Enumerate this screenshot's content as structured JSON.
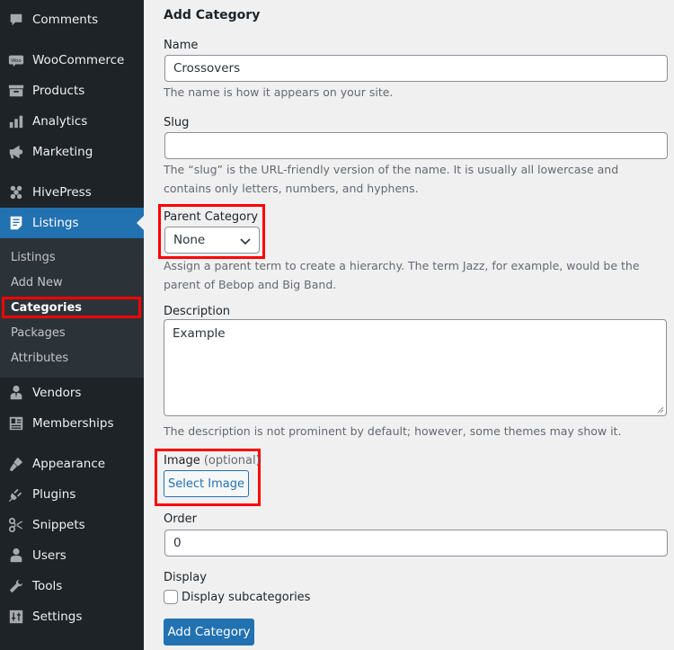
{
  "sidebar": {
    "items": [
      {
        "label": "Comments",
        "icon": "comment-icon"
      },
      {
        "label": "WooCommerce",
        "icon": "woo-icon"
      },
      {
        "label": "Products",
        "icon": "archive-icon"
      },
      {
        "label": "Analytics",
        "icon": "bar-chart-icon"
      },
      {
        "label": "Marketing",
        "icon": "megaphone-icon"
      },
      {
        "label": "HivePress",
        "icon": "hivepress-icon"
      },
      {
        "label": "Listings",
        "icon": "listing-icon",
        "active": true
      },
      {
        "label": "Vendors",
        "icon": "businessperson-icon"
      },
      {
        "label": "Memberships",
        "icon": "id-card-icon"
      },
      {
        "label": "Appearance",
        "icon": "paintbrush-icon"
      },
      {
        "label": "Plugins",
        "icon": "plug-icon"
      },
      {
        "label": "Snippets",
        "icon": "scissors-icon"
      },
      {
        "label": "Users",
        "icon": "user-icon"
      },
      {
        "label": "Tools",
        "icon": "wrench-icon"
      },
      {
        "label": "Settings",
        "icon": "sliders-icon"
      }
    ],
    "submenu": [
      {
        "label": "Listings"
      },
      {
        "label": "Add New"
      },
      {
        "label": "Categories",
        "current": true
      },
      {
        "label": "Packages"
      },
      {
        "label": "Attributes"
      }
    ]
  },
  "form": {
    "title": "Add Category",
    "name": {
      "label": "Name",
      "value": "Crossovers",
      "help": "The name is how it appears on your site."
    },
    "slug": {
      "label": "Slug",
      "value": "",
      "help": "The “slug” is the URL-friendly version of the name. It is usually all lowercase and contains only letters, numbers, and hyphens."
    },
    "parent": {
      "label": "Parent Category",
      "value": "None",
      "help": "Assign a parent term to create a hierarchy. The term Jazz, for example, would be the parent of Bebop and Big Band."
    },
    "description": {
      "label": "Description",
      "value": "Example",
      "help": "The description is not prominent by default; however, some themes may show it."
    },
    "image": {
      "label": "Image",
      "optional": "(optional)",
      "button": "Select Image"
    },
    "order": {
      "label": "Order",
      "value": "0"
    },
    "display": {
      "label": "Display",
      "checkbox_label": "Display subcategories",
      "checked": false
    },
    "submit": "Add Category"
  },
  "colors": {
    "accent": "#2271b1",
    "sidebar": "#1d2327",
    "highlight": "#ff0000"
  }
}
